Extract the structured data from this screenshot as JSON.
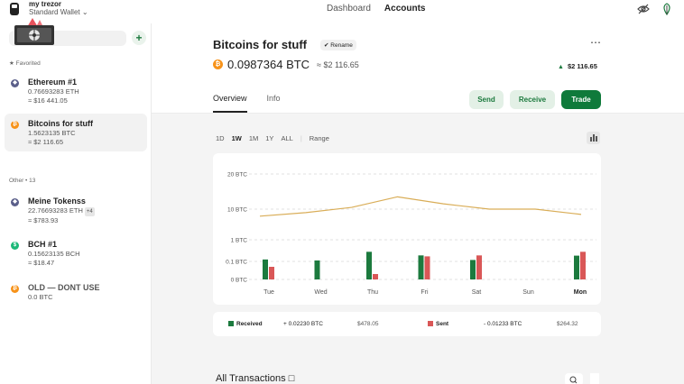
{
  "device": {
    "name": "my trezor",
    "wallet": "Standard Wallet"
  },
  "nav": {
    "dashboard": "Dashboard",
    "accounts": "Accounts"
  },
  "sidebar": {
    "favorited_label": "Favorited",
    "other_label": "Other • 13",
    "favorited": [
      {
        "name": "Ethereum #1",
        "crypto": "0.76693283 ETH",
        "fiat": "≈ $16 441.05",
        "coin": "eth",
        "color": "#5b5f8a"
      },
      {
        "name": "Bitcoins for stuff",
        "crypto": "1.5623135 BTC",
        "fiat": "≈ $2 116.65",
        "coin": "btc",
        "color": "#f7931a"
      }
    ],
    "other": [
      {
        "name": "Meine Tokenss",
        "crypto": "22.76693283 ETH",
        "badge": "+4",
        "fiat": "≈ $783.93",
        "coin": "eth",
        "color": "#5b5f8a"
      },
      {
        "name": "BCH #1",
        "crypto": "0.15623135 BCH",
        "fiat": "≈ $18.47",
        "coin": "bch",
        "color": "#1cb978"
      },
      {
        "name": "OLD — DONT USE",
        "crypto": "0.0 BTC",
        "coin": "btc",
        "color": "#f7931a"
      }
    ]
  },
  "account": {
    "title": "Bitcoins for stuff",
    "rename": "Rename",
    "balance_crypto": "0.0987364 BTC",
    "balance_fiat": "≈ $2 116.65",
    "change": "$2 116.65",
    "tabs": [
      "Overview",
      "Info"
    ],
    "actions": {
      "send": "Send",
      "receive": "Receive",
      "trade": "Trade"
    }
  },
  "ranges": [
    "1D",
    "1W",
    "1M",
    "1Y",
    "ALL"
  ],
  "range_selected": "1W",
  "range_custom": "Range",
  "legend": {
    "received_label": "Received",
    "received_crypto": "+ 0.02230 BTC",
    "received_fiat": "$478.05",
    "sent_label": "Sent",
    "sent_crypto": "- 0.01233 BTC",
    "sent_fiat": "$264.32"
  },
  "transactions_title": "All Transactions",
  "colors": {
    "accent": "#0f7a3b",
    "received": "#1c7a3e",
    "sent": "#d95757",
    "btc": "#f7931a",
    "line": "#d9ad57"
  },
  "chart_data": {
    "type": "bar",
    "categories": [
      "Tue",
      "Wed",
      "Thu",
      "Fri",
      "Sat",
      "Sun",
      "Mon"
    ],
    "y_ticks": [
      "20 BTC",
      "10 BTC",
      "1 BTC",
      "0.1 BTC",
      "0 BTC"
    ],
    "y_tick_values": [
      20,
      10,
      1,
      0.1,
      0
    ],
    "series": [
      {
        "name": "Received",
        "values": [
          0.18,
          0.14,
          0.5,
          0.35,
          0.16,
          0,
          0.34
        ]
      },
      {
        "name": "Sent",
        "values": [
          0.07,
          0,
          0.03,
          0.31,
          0.35,
          0,
          0.5
        ]
      }
    ],
    "balance_line": [
      8,
      9,
      10.5,
      13.5,
      11.5,
      10,
      10,
      8.5
    ]
  }
}
